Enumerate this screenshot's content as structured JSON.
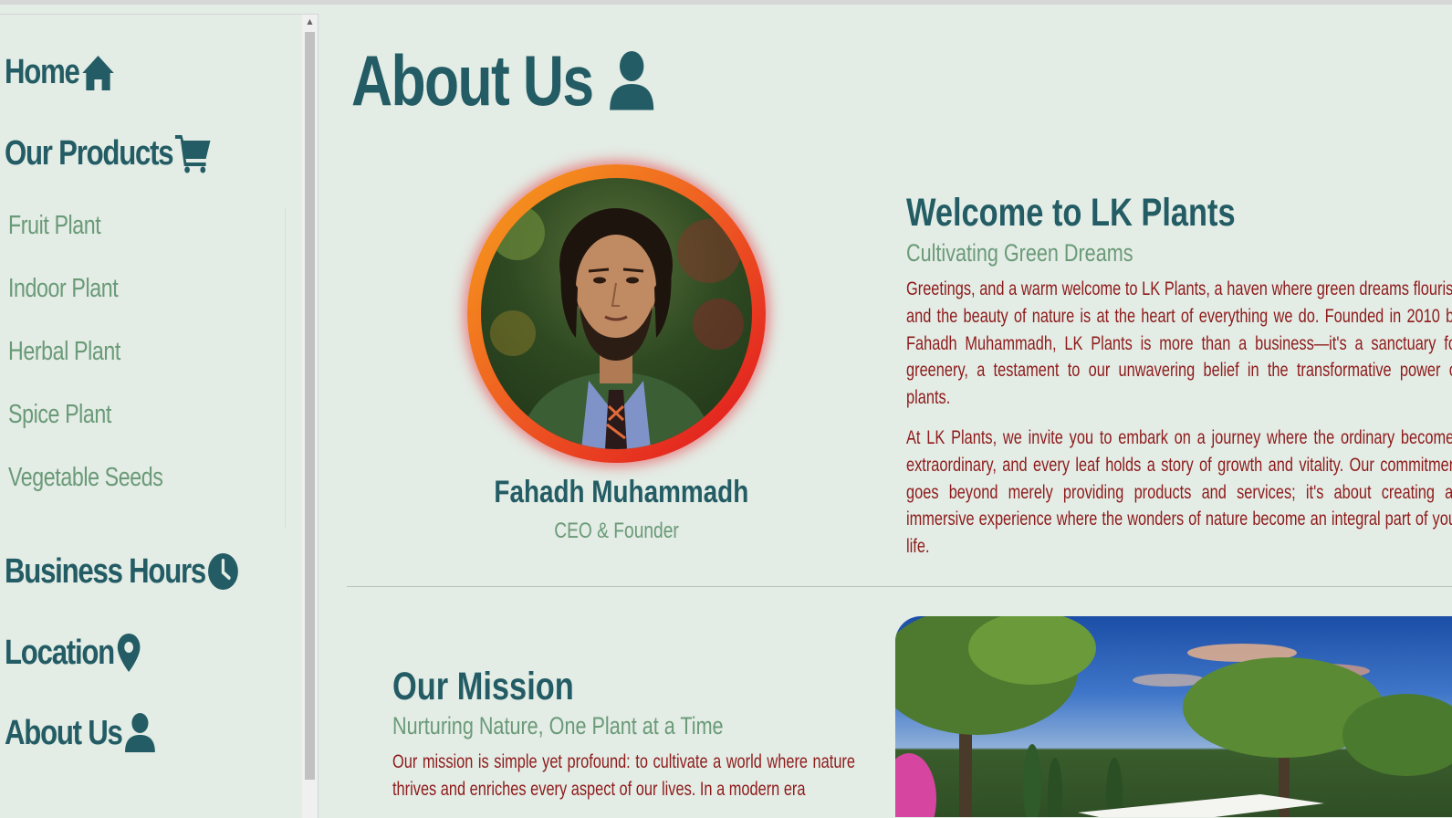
{
  "sidebar": {
    "nav": [
      {
        "label": "Home",
        "icon": "home-icon"
      },
      {
        "label": "Our Products",
        "icon": "cart-icon"
      },
      {
        "label": "Business Hours",
        "icon": "clock-icon"
      },
      {
        "label": "Location",
        "icon": "map-pin-icon"
      },
      {
        "label": "About Us",
        "icon": "user-icon"
      }
    ],
    "products": [
      "Fruit Plant",
      "Indoor Plant",
      "Herbal Plant",
      "Spice Plant",
      "Vegetable Seeds"
    ]
  },
  "page": {
    "title": "About Us",
    "title_icon": "user-icon"
  },
  "profile": {
    "name": "Fahadh Muhammadh",
    "role": "CEO & Founder"
  },
  "welcome": {
    "title": "Welcome to LK Plants",
    "subtitle": "Cultivating Green Dreams",
    "paragraph1": "Greetings, and a warm welcome to LK Plants, a haven where green dreams flourish and the beauty of nature is at the heart of everything we do. Founded in 2010 by Fahadh Muhammadh, LK Plants is more than a business—it's a sanctuary for greenery, a testament to our unwavering belief in the transformative power of plants.",
    "paragraph2": "At LK Plants, we invite you to embark on a journey where the ordinary becomes extraordinary, and every leaf holds a story of growth and vitality. Our commitment goes beyond merely providing products and services; it's about creating an immersive experience where the wonders of nature become an integral part of your life."
  },
  "mission": {
    "title": "Our Mission",
    "subtitle": "Nurturing Nature, One Plant at a Time",
    "paragraph": "Our mission is simple yet profound: to cultivate a world where nature thrives and enriches every aspect of our lives. In a modern era"
  },
  "colors": {
    "background": "#e3ece5",
    "primary": "#235c64",
    "secondary": "#6a9a78",
    "text_body": "#8e1b1b",
    "ring_start": "#f7a21b",
    "ring_end": "#e0121f"
  }
}
